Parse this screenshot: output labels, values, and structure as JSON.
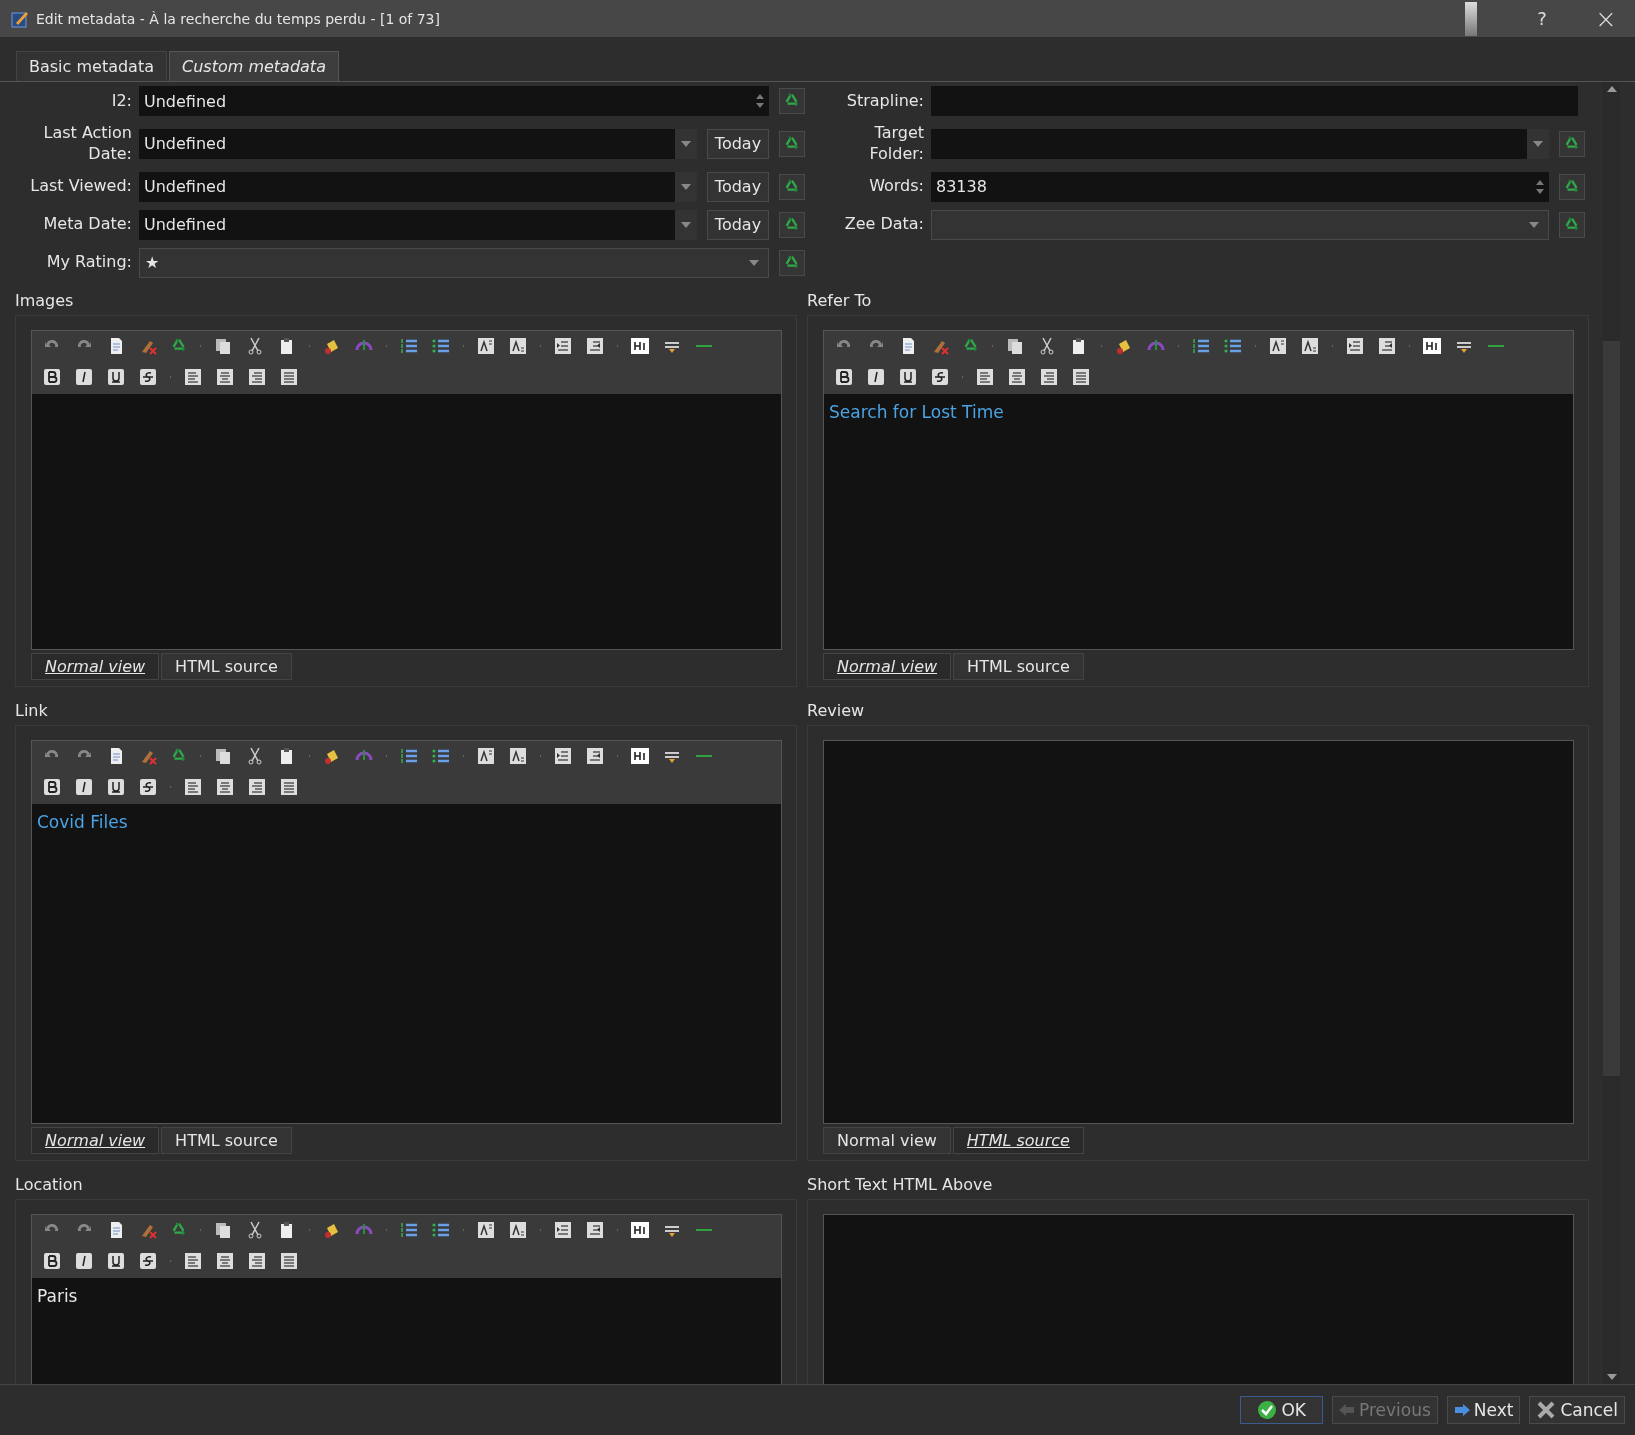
{
  "window": {
    "title": "Edit metadata - À la recherche du temps perdu -  [1 of 73]",
    "controls": [
      {
        "kind": "help",
        "label": "?"
      },
      {
        "kind": "close",
        "label": "×"
      }
    ]
  },
  "tabs": [
    {
      "label": "Basic metadata",
      "selected": false
    },
    {
      "label": "Custom metadata",
      "selected": true
    }
  ],
  "fields_left": [
    {
      "kind": "spinner",
      "label": "I2:",
      "value": "Undefined",
      "reset": true
    },
    {
      "kind": "date",
      "label": "Last Action Date:",
      "value": "Undefined",
      "button": "Today",
      "reset": true
    },
    {
      "kind": "date",
      "label": "Last Viewed:",
      "value": "Undefined",
      "button": "Today",
      "reset": true
    },
    {
      "kind": "date",
      "label": "Meta Date:",
      "value": "Undefined",
      "button": "Today",
      "reset": true
    },
    {
      "kind": "dropdown",
      "label": "My Rating:",
      "value": "★",
      "reset": true
    }
  ],
  "fields_right": [
    {
      "kind": "text",
      "label": "Strapline:",
      "reset": false
    },
    {
      "kind": "combo",
      "label": "Target Folder:",
      "reset": true
    },
    {
      "kind": "spinner",
      "label": "Words:",
      "value": "83138",
      "reset": true
    },
    {
      "kind": "dropdown",
      "label": "Zee Data:",
      "reset": true
    }
  ],
  "editors": [
    {
      "title": "Images",
      "toolbar": true,
      "views": [
        {
          "label": "Normal view",
          "selected": true
        },
        {
          "label": "HTML source",
          "selected": false
        }
      ]
    },
    {
      "title": "Refer To",
      "toolbar": true,
      "content": {
        "kind": "link",
        "text": "Search for Lost Time"
      },
      "views": [
        {
          "label": "Normal view",
          "selected": true
        },
        {
          "label": "HTML source",
          "selected": false
        }
      ]
    },
    {
      "title": "Link",
      "toolbar": true,
      "content": {
        "kind": "link",
        "text": "Covid Files"
      },
      "views": [
        {
          "label": "Normal view",
          "selected": true
        },
        {
          "label": "HTML source",
          "selected": false
        }
      ]
    },
    {
      "title": "Review",
      "toolbar": false,
      "views": [
        {
          "label": "Normal view",
          "selected": false
        },
        {
          "label": "HTML source",
          "selected": true
        }
      ]
    },
    {
      "title": "Location",
      "toolbar": true,
      "content": {
        "kind": "plain",
        "text": "Paris"
      }
    },
    {
      "title": "Short Text HTML Above",
      "toolbar": false
    }
  ],
  "buttons": [
    {
      "kind": "ok",
      "label": "OK",
      "disabled": false
    },
    {
      "kind": "previous",
      "label": "Previous",
      "disabled": true
    },
    {
      "kind": "next",
      "label": "Next",
      "disabled": false
    },
    {
      "kind": "cancel",
      "label": "Cancel",
      "disabled": false
    }
  ]
}
